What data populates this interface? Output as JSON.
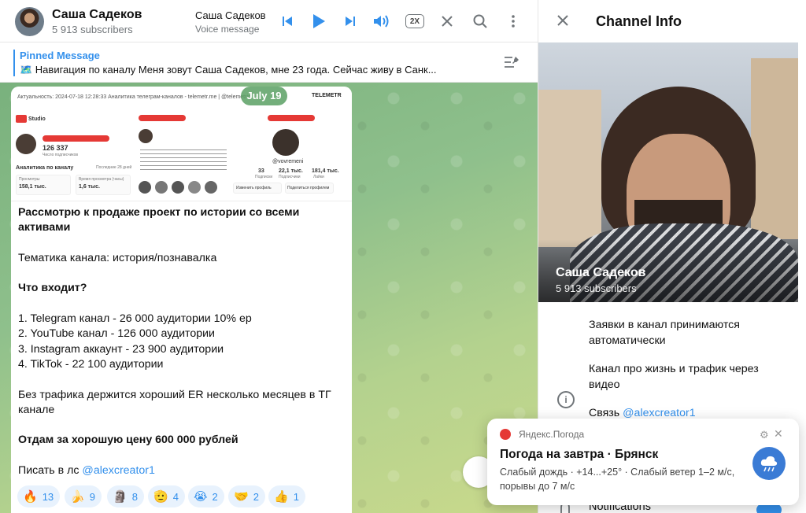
{
  "header": {
    "chat_title": "Саша Садеков",
    "chat_subscribers": "5 913 subscribers",
    "player_title": "Саша Садеков",
    "player_subtitle": "Voice message",
    "speed_label": "2X",
    "icons": [
      "skip-previous-icon",
      "play-icon",
      "skip-next-icon",
      "volume-icon",
      "close-icon",
      "search-icon",
      "more-vertical-icon"
    ]
  },
  "pinned": {
    "title": "Pinned Message",
    "text": "🗺️ Навигация по каналу Меня зовут Саша Садеков, мне 23 года. Сейчас живу в Санк..."
  },
  "date_pill": "July 19",
  "image_preview": {
    "topline": "Актуальность: 2024-07-18 12:28:33  Аналитика телеграм-каналов - telemetr.me | @telemetrio",
    "telemetr": "TELEMETR",
    "studio_label": "Studio",
    "subs_count": "126 337",
    "subs_caption": "Число подписчиков",
    "analytics_label": "Аналитика по каналу",
    "analytics_period": "Последние 28 дней",
    "views_label": "Просмотры",
    "views_value": "158,1 тыс.",
    "watch_label": "Время просмотра (часы)",
    "watch_value": "1,6 тыс.",
    "profile_handle": "@vovremeni",
    "stat1": "33",
    "stat2": "22,1 тыс.",
    "stat3": "181,4 тыс.",
    "stat1_label": "Подписки",
    "stat2_label": "Подписчики",
    "stat3_label": "Лайки",
    "edit_profile": "Изменить профиль",
    "share_profile": "Поделиться профилем"
  },
  "message": {
    "p1": "Рассмотрю к продаже проект по истории со всеми активами",
    "p2": "Тематика канала: история/познавалка",
    "p3": "Что входит?",
    "items": [
      "1. Telegram канал - 26 000 аудитории 10% ep",
      "2. YouTube канал - 126 000 аудитории",
      "3. Instagram аккаунт - 23 900 аудитории",
      "4. TikTok - 22 100 аудитории"
    ],
    "p4": "Без трафика держится хороший ER несколько месяцев в ТГ канале",
    "p5": "Отдам за хорошую цену 600 000 рублей",
    "p6_prefix": "Писать в лс ",
    "p6_link": "@alexcreator1"
  },
  "reactions": [
    {
      "emoji": "🔥",
      "count": "13"
    },
    {
      "emoji": "🍌",
      "count": "9"
    },
    {
      "emoji": "🗿",
      "count": "8"
    },
    {
      "emoji": "🫡",
      "count": "4"
    },
    {
      "emoji": "😭",
      "count": "2"
    },
    {
      "emoji": "🤝",
      "count": "2"
    },
    {
      "emoji": "👍",
      "count": "1"
    }
  ],
  "panel": {
    "title": "Channel Info",
    "name": "Саша Садеков",
    "subscribers": "5 913 subscribers",
    "desc1": "Заявки в канал принимаются автоматически",
    "desc2": "Канал про жизнь и трафик через видео",
    "desc3_prefix": "Связь ",
    "desc3_link": "@alexcreator1",
    "notifications_label": "Notifications",
    "notifications_on": true
  },
  "weather": {
    "source": "Яндекс.Погода",
    "title": "Погода на завтра · Брянск",
    "description": "Слабый дождь · +14...+25° · Слабый ветер 1–2 м/с, порывы до 7 м/с"
  },
  "colors": {
    "accent": "#3390ec",
    "chat_bg_start": "#79b17d",
    "chat_bg_end": "#c9d98c",
    "reaction_bg": "#e8f2fd"
  }
}
